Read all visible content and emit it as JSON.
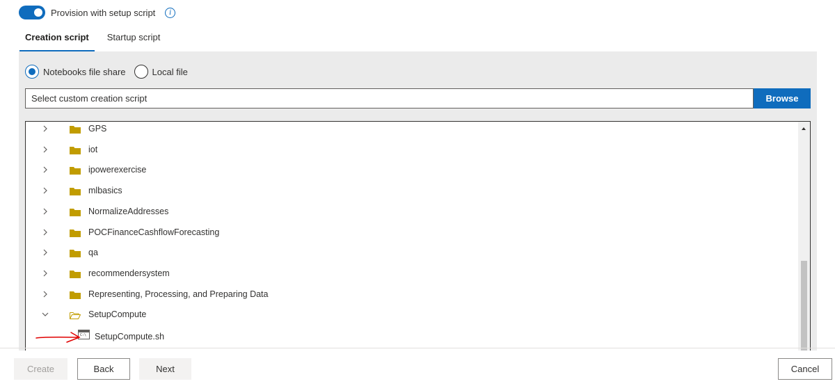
{
  "provision": {
    "toggle_label": "Provision with setup script",
    "enabled": true
  },
  "tabs": [
    {
      "label": "Creation script",
      "active": true
    },
    {
      "label": "Startup script",
      "active": false
    }
  ],
  "source": {
    "options": [
      {
        "label": "Notebooks file share",
        "checked": true
      },
      {
        "label": "Local file",
        "checked": false
      }
    ],
    "placeholder": "Select custom creation script",
    "browse_label": "Browse"
  },
  "tree": {
    "folders": [
      {
        "label": "GPS",
        "expanded": false
      },
      {
        "label": "iot",
        "expanded": false
      },
      {
        "label": "ipowerexercise",
        "expanded": false
      },
      {
        "label": "mlbasics",
        "expanded": false
      },
      {
        "label": "NormalizeAddresses",
        "expanded": false
      },
      {
        "label": "POCFinanceCashflowForecasting",
        "expanded": false
      },
      {
        "label": "qa",
        "expanded": false
      },
      {
        "label": "recommendersystem",
        "expanded": false
      },
      {
        "label": "Representing, Processing, and Preparing Data",
        "expanded": false
      },
      {
        "label": "SetupCompute",
        "expanded": true
      }
    ],
    "file": {
      "label": "SetupCompute.sh"
    },
    "file_icon_text": "C:\\",
    "folder_color": "#c19c00"
  },
  "footer": {
    "create_label": "Create",
    "back_label": "Back",
    "next_label": "Next",
    "cancel_label": "Cancel"
  },
  "colors": {
    "accent": "#0f6cbd",
    "annotation": "#e00000"
  }
}
